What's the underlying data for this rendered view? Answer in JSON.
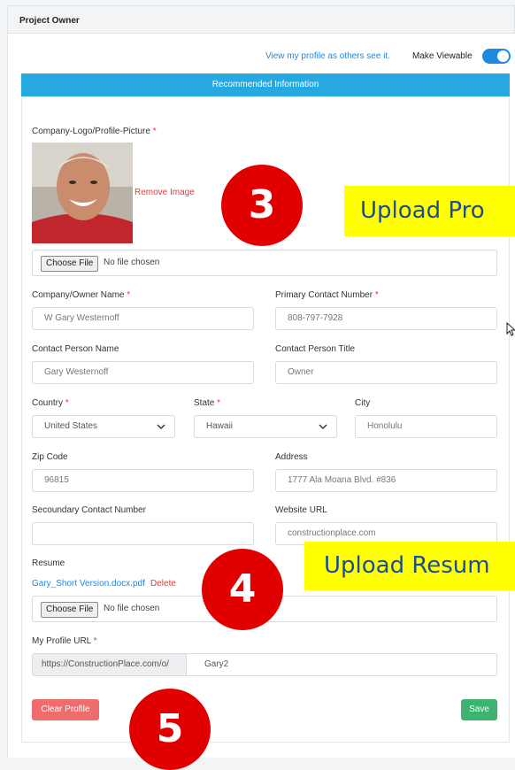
{
  "header": {
    "title": "Project Owner"
  },
  "profile_bar": {
    "view_link": "View my profile as others see it.",
    "viewable_label": "Make Viewable",
    "viewable_on": true
  },
  "banner": {
    "text": "Recommended Information"
  },
  "logo": {
    "label": "Company-Logo/Profile-Picture",
    "required": "*",
    "remove_label": "Remove Image"
  },
  "file_input": {
    "button": "Choose File",
    "status": "No file chosen"
  },
  "fields": {
    "company_name": {
      "label": "Company/Owner Name",
      "value": "W Gary Westernoff"
    },
    "primary_contact": {
      "label": "Primary Contact Number",
      "value": "808-797-7928"
    },
    "contact_person": {
      "label": "Contact Person Name",
      "value": "Gary Westernoff"
    },
    "contact_title": {
      "label": "Contact Person Title",
      "value": "Owner"
    },
    "country": {
      "label": "Country",
      "value": "United States"
    },
    "state": {
      "label": "State",
      "value": "Hawaii"
    },
    "city": {
      "label": "City",
      "value": "Honolulu"
    },
    "zip": {
      "label": "Zip Code",
      "value": "96815"
    },
    "address": {
      "label": "Address",
      "value": "1777 Ala Moana Blvd. #836"
    },
    "secondary_contact": {
      "label": "Secoundary Contact Number",
      "value": ""
    },
    "website": {
      "label": "Website URL",
      "value": "constructionplace.com"
    }
  },
  "resume": {
    "label": "Resume",
    "file": "Gary_Short Version.docx.pdf",
    "delete_label": "Delete"
  },
  "profile_url": {
    "label": "My Profile URL",
    "prefix": "https://ConstructionPlace.com/o/",
    "value": "Gary2"
  },
  "actions": {
    "clear": "Clear Profile",
    "save": "Save"
  },
  "annotations": {
    "step3": "3",
    "step4": "4",
    "step5": "5",
    "callout3": "Upload Pro",
    "callout4": "Upload Resum"
  },
  "colors": {
    "accent": "#26a9e0",
    "link": "#1e88e5",
    "danger": "#f06b6b",
    "success": "#3cb371",
    "required": "#e53935"
  }
}
